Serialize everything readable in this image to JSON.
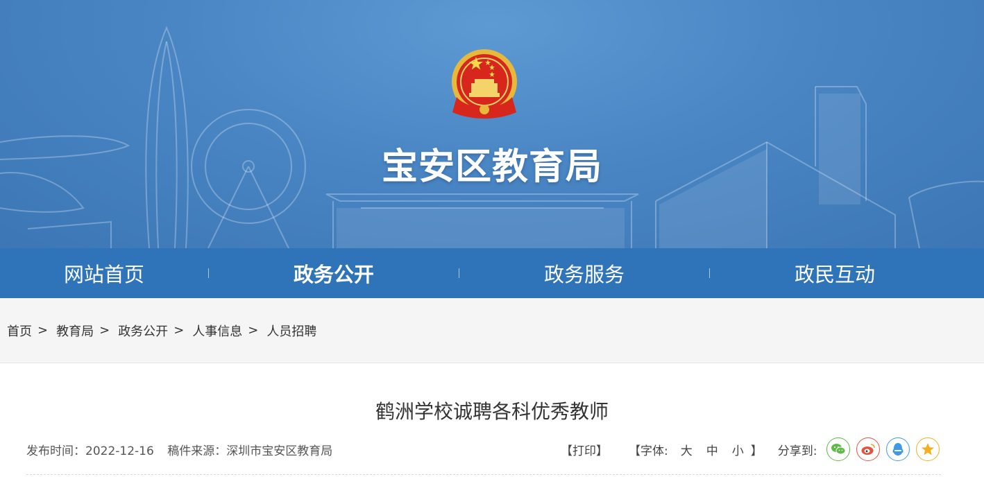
{
  "banner": {
    "site_title": "宝安区教育局"
  },
  "nav": {
    "items": [
      {
        "label": "网站首页"
      },
      {
        "label": "政务公开"
      },
      {
        "label": "政务服务"
      },
      {
        "label": "政民互动"
      }
    ],
    "active_index": 1
  },
  "breadcrumb": {
    "items": [
      "首页",
      "教育局",
      "政务公开",
      "人事信息",
      "人员招聘"
    ],
    "separator": ">"
  },
  "article": {
    "title": "鹤洲学校诚聘各科优秀教师",
    "publish_label": "发布时间：",
    "publish_date": "2022-12-16",
    "source_label": "稿件来源：",
    "source": "深圳市宝安区教育局",
    "print_label": "【打印】",
    "font_label": "【字体:",
    "font_large": "大",
    "font_medium": "中",
    "font_small": "小",
    "font_close": "】",
    "share_label": "分享到:"
  },
  "share": [
    {
      "name": "wechat-icon",
      "color": "#5fb84a"
    },
    {
      "name": "weibo-icon",
      "color": "#e2533f"
    },
    {
      "name": "qq-icon",
      "color": "#3d9ae8"
    },
    {
      "name": "qzone-icon",
      "color": "#f2b01e"
    }
  ],
  "colors": {
    "nav_bg": "#2f73b8",
    "banner_bg": "#4a86c4",
    "crumb_bg": "#f5f5f5"
  }
}
